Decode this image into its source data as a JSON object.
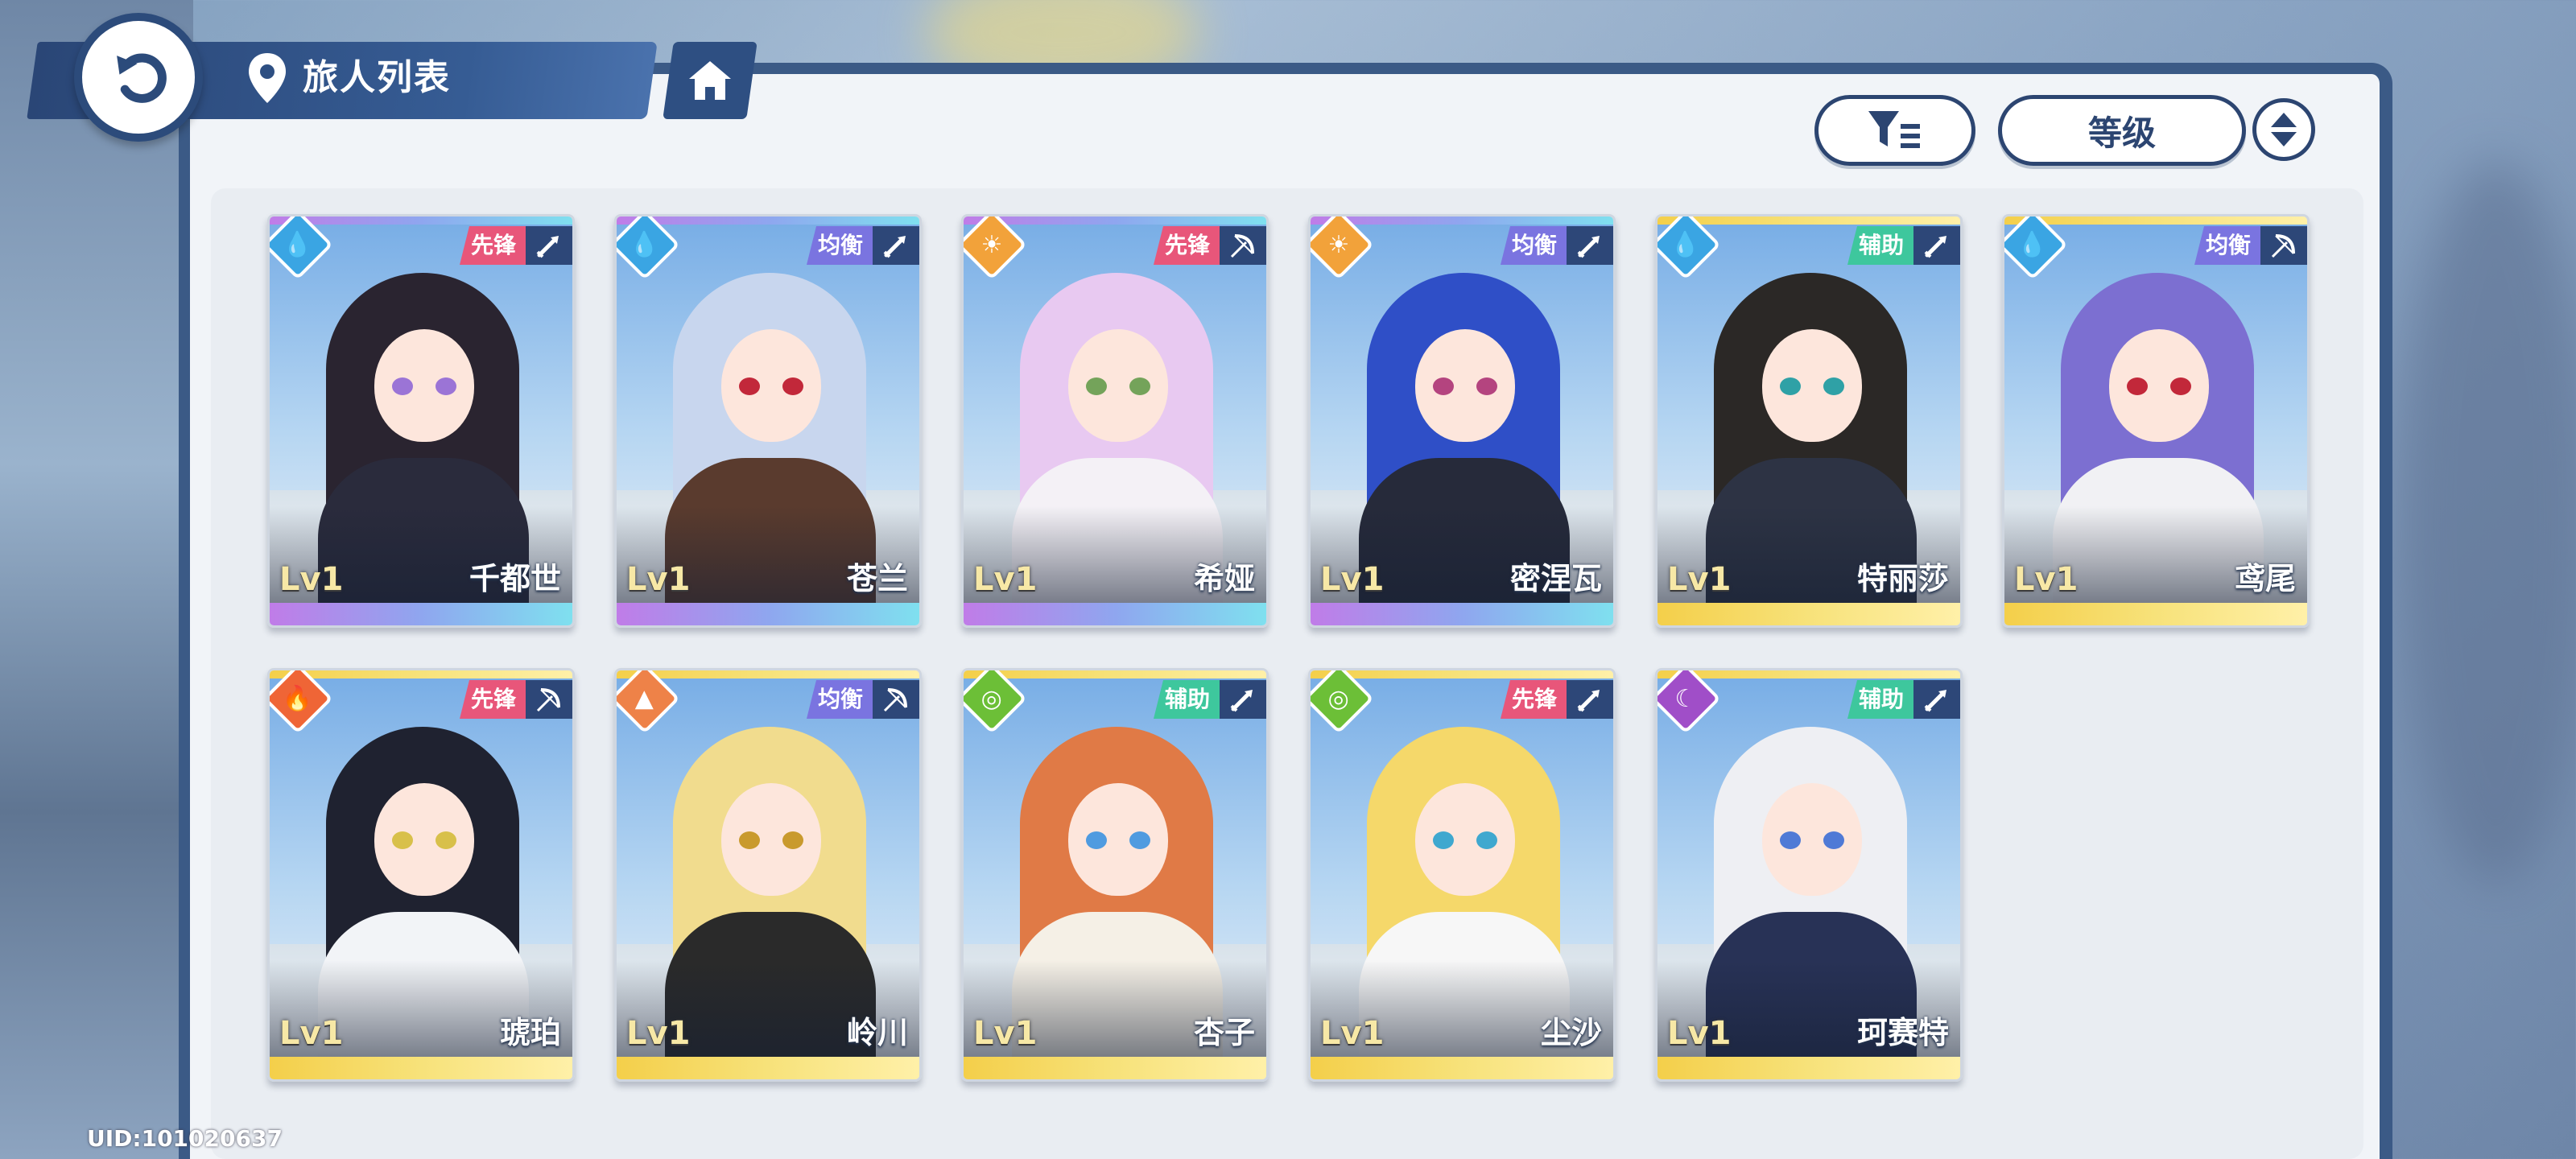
{
  "header": {
    "title": "旅人列表",
    "back_icon": "back-arrow-icon",
    "location_icon": "map-pin-icon",
    "home_icon": "home-icon"
  },
  "toolbar": {
    "filter_icon": "filter-icon",
    "sort_label": "等级",
    "order_icon": "sort-order-icon"
  },
  "roles_colors": {
    "先锋": "#e8567a",
    "均衡": "#7a74e0",
    "辅助": "#3ec79d"
  },
  "elements_colors": {
    "water": "#3aa5e3",
    "sun": "#f2a23a",
    "fire": "#ef6536",
    "earth": "#ee8248",
    "wind": "#6cbf37",
    "moon": "#a04ec8"
  },
  "cards": [
    {
      "name": "千都世",
      "level": "Lv1",
      "role": "先锋",
      "weapon": "sword-icon",
      "element": "water",
      "rarity": "purple",
      "hair": "#2a2430",
      "eye": "#9b74d6",
      "outfit": "#2a2b3c"
    },
    {
      "name": "苍兰",
      "level": "Lv1",
      "role": "均衡",
      "weapon": "sword-icon",
      "element": "water",
      "rarity": "purple",
      "hair": "#c8d6ee",
      "eye": "#c2283a",
      "outfit": "#5a3b2e"
    },
    {
      "name": "希娅",
      "level": "Lv1",
      "role": "先锋",
      "weapon": "bow-icon",
      "element": "sun",
      "rarity": "purple",
      "hair": "#e8c9f1",
      "eye": "#74a35a",
      "outfit": "#f4f1f6"
    },
    {
      "name": "密涅瓦",
      "level": "Lv1",
      "role": "均衡",
      "weapon": "sword-icon",
      "element": "sun",
      "rarity": "purple",
      "hair": "#2f4fc7",
      "eye": "#b4447f",
      "outfit": "#262a3a"
    },
    {
      "name": "特丽莎",
      "level": "Lv1",
      "role": "辅助",
      "weapon": "sword-icon",
      "element": "water",
      "rarity": "gold",
      "hair": "#2b2826",
      "eye": "#2fa1a6",
      "outfit": "#2d3344"
    },
    {
      "name": "鸢尾",
      "level": "Lv1",
      "role": "均衡",
      "weapon": "bow-icon",
      "element": "water",
      "rarity": "gold",
      "hair": "#7c6fd1",
      "eye": "#c2283a",
      "outfit": "#f1f1f4"
    },
    {
      "name": "琥珀",
      "level": "Lv1",
      "role": "先锋",
      "weapon": "bow-icon",
      "element": "fire",
      "rarity": "gold",
      "hair": "#1f2230",
      "eye": "#d8c04a",
      "outfit": "#f2f4f7"
    },
    {
      "name": "岭川",
      "level": "Lv1",
      "role": "均衡",
      "weapon": "bow-icon",
      "element": "earth",
      "rarity": "gold",
      "hair": "#f1dc8e",
      "eye": "#c99a2d",
      "outfit": "#2a2a2a"
    },
    {
      "name": "杏子",
      "level": "Lv1",
      "role": "辅助",
      "weapon": "sword-icon",
      "element": "wind",
      "rarity": "gold",
      "hair": "#e07a46",
      "eye": "#4f9be0",
      "outfit": "#f5f0e6"
    },
    {
      "name": "尘沙",
      "level": "Lv1",
      "role": "先锋",
      "weapon": "sword-icon",
      "element": "wind",
      "rarity": "gold",
      "hair": "#f5d86a",
      "eye": "#3fa8cf",
      "outfit": "#f7f7f7"
    },
    {
      "name": "珂赛特",
      "level": "Lv1",
      "role": "辅助",
      "weapon": "sword-icon",
      "element": "moon",
      "rarity": "gold",
      "hair": "#eeeff3",
      "eye": "#4f7ad6",
      "outfit": "#283256"
    }
  ],
  "footer": {
    "uid": "UID:101020637"
  }
}
